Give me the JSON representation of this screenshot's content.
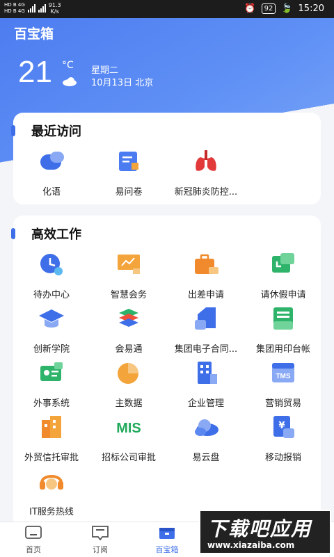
{
  "status_bar": {
    "sim1": "HD B 4G",
    "sim2": "HD B 4G",
    "speed_value": "91.3",
    "speed_unit": "K/s",
    "battery": "92",
    "time": "15:20"
  },
  "header": {
    "title": "百宝箱",
    "temperature": "21",
    "unit": "°C",
    "weather_icon": "cloud-icon",
    "weekday": "星期二",
    "date_city": "10月13日 北京"
  },
  "recent": {
    "title": "最近访问",
    "items": [
      {
        "label": "化语",
        "icon": "chat-icon"
      },
      {
        "label": "易问卷",
        "icon": "survey-icon"
      },
      {
        "label": "新冠肺炎防控...",
        "icon": "lungs-icon"
      }
    ]
  },
  "work": {
    "title": "高效工作",
    "items": [
      {
        "label": "待办中心",
        "icon": "clock-icon"
      },
      {
        "label": "智慧会务",
        "icon": "presentation-icon"
      },
      {
        "label": "出差申请",
        "icon": "suitcase-icon"
      },
      {
        "label": "请休假申请",
        "icon": "leave-icon"
      },
      {
        "label": "创新学院",
        "icon": "graduation-cap-icon"
      },
      {
        "label": "会易通",
        "icon": "stack-icon"
      },
      {
        "label": "集团电子合同...",
        "icon": "contract-icon"
      },
      {
        "label": "集团用印台帐",
        "icon": "ledger-icon"
      },
      {
        "label": "外事系统",
        "icon": "id-card-icon"
      },
      {
        "label": "主数据",
        "icon": "pie-chart-icon"
      },
      {
        "label": "企业管理",
        "icon": "building-icon"
      },
      {
        "label": "营销贸易",
        "icon": "tms-icon"
      },
      {
        "label": "外贸信托审批",
        "icon": "trust-icon"
      },
      {
        "label": "招标公司审批",
        "icon": "mis-icon"
      },
      {
        "label": "易云盘",
        "icon": "cloud-disk-icon"
      },
      {
        "label": "移动报销",
        "icon": "reimburse-icon"
      },
      {
        "label": "IT服务热线",
        "icon": "headset-icon"
      }
    ]
  },
  "tabbar": {
    "tabs": [
      {
        "label": "首页",
        "icon": "home-icon"
      },
      {
        "label": "订阅",
        "icon": "subscribe-icon"
      },
      {
        "label": "百宝箱",
        "icon": "toolbox-icon",
        "active": true
      }
    ]
  },
  "watermark": {
    "main": "下载吧应用",
    "url": "www.xiazaiba.com"
  },
  "colors": {
    "accent": "#3f6fe8",
    "hero": "#5a8cf4"
  }
}
